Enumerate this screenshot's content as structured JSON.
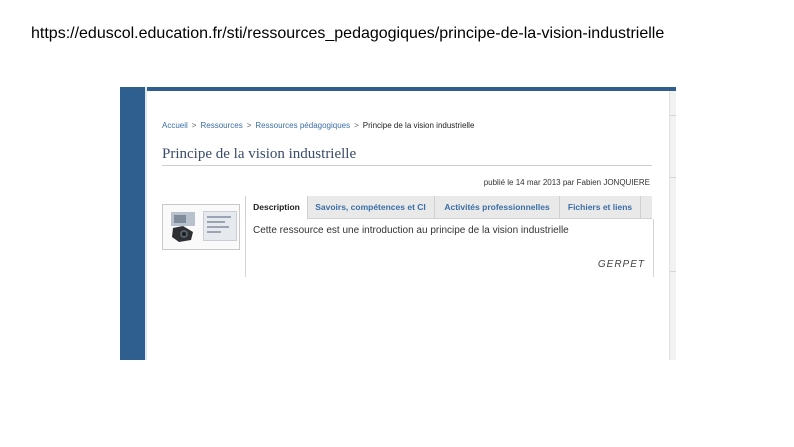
{
  "slide": {
    "url_text": "https://eduscol.education.fr/sti/ressources_pedagogiques/principe-de-la-vision-industrielle"
  },
  "breadcrumb": {
    "items": [
      "Accueil",
      "Ressources",
      "Ressources pédagogiques"
    ],
    "separator": ">",
    "current": "Principe de la vision industrielle"
  },
  "page": {
    "title": "Principe de la vision industrielle",
    "byline": "publié le 14 mar 2013 par Fabien JONQUIERE"
  },
  "tabs": [
    {
      "label": "Description",
      "active": true
    },
    {
      "label": "Savoirs, compétences et CI",
      "active": false
    },
    {
      "label": "Activités professionnelles",
      "active": false
    },
    {
      "label": "Fichiers et liens",
      "active": false
    }
  ],
  "description": {
    "text": "Cette ressource est une introduction au principe de la vision industrielle",
    "signature": "GERPET"
  },
  "colors": {
    "band": "#2e5f8e",
    "link": "#3a6ea5",
    "title": "#3a4a6a",
    "tab_bar": "#e9e9e9"
  }
}
